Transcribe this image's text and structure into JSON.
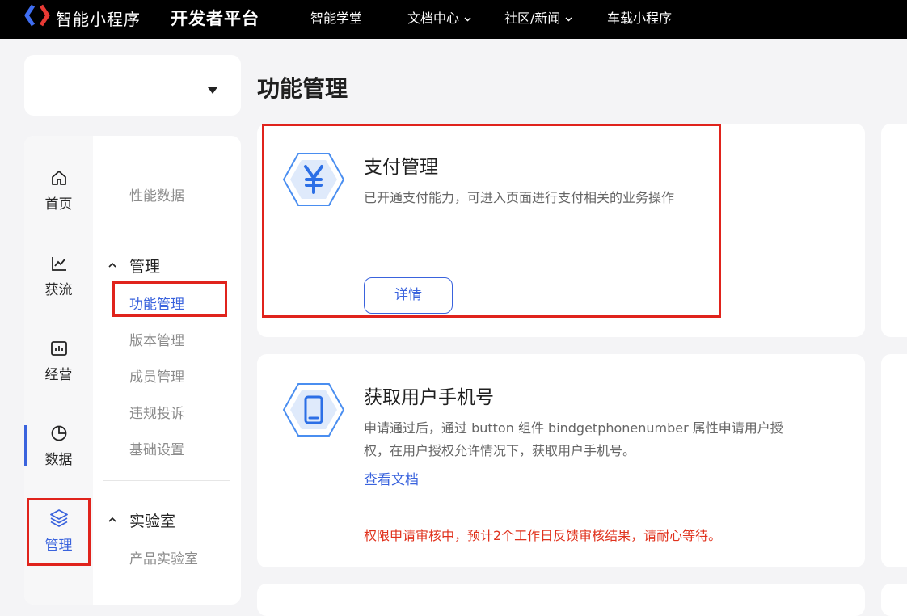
{
  "header": {
    "brand": "智能小程序",
    "platform": "开发者平台",
    "nav": [
      {
        "label": "智能学堂",
        "has_dropdown": false
      },
      {
        "label": "文档中心",
        "has_dropdown": true
      },
      {
        "label": "社区/新闻",
        "has_dropdown": true
      },
      {
        "label": "车载小程序",
        "has_dropdown": false
      }
    ]
  },
  "app_selector": {
    "value": ""
  },
  "sidebar": {
    "primary": [
      {
        "label": "首页",
        "icon": "home-icon"
      },
      {
        "label": "获流",
        "icon": "line-chart-icon"
      },
      {
        "label": "经营",
        "icon": "bar-chart-icon"
      },
      {
        "label": "数据",
        "icon": "pie-chart-icon"
      },
      {
        "label": "管理",
        "icon": "layers-icon",
        "active": true
      }
    ],
    "secondary": {
      "top_item": "性能数据",
      "groups": [
        {
          "title": "管理",
          "items": [
            "功能管理",
            "版本管理",
            "成员管理",
            "违规投诉",
            "基础设置"
          ]
        },
        {
          "title": "实验室",
          "items": [
            "产品实验室"
          ]
        }
      ],
      "current": "功能管理"
    }
  },
  "main": {
    "title": "功能管理",
    "cards": [
      {
        "icon": "yuan-icon",
        "title": "支付管理",
        "desc": "已开通支付能力，可进入页面进行支付相关的业务操作",
        "button": "详情"
      },
      {
        "icon": "phone-icon",
        "title": "获取用户手机号",
        "desc_line1": "申请通过后，通过 button 组件 bindgetphonenumber 属性申请用户授",
        "desc_line2": "权，在用户授权允许情况下，获取用户手机号。",
        "link": "查看文档",
        "status": "权限申请审核中，预计2个工作日反馈审核结果，请耐心等待。"
      }
    ]
  },
  "colors": {
    "accent": "#3a63dd",
    "highlight": "#e0231c",
    "warning": "#e0321d"
  }
}
